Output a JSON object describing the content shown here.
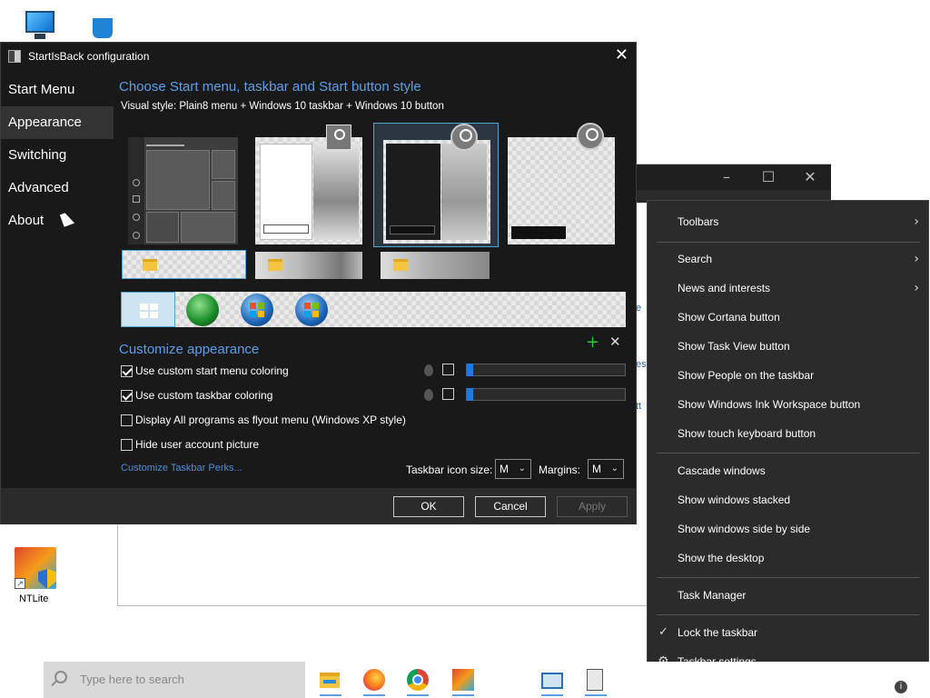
{
  "dialog": {
    "title": "StartIsBack configuration",
    "sidebar": [
      "Start Menu",
      "Appearance",
      "Switching",
      "Advanced",
      "About"
    ],
    "active_index": 1,
    "heading": "Choose Start menu, taskbar and Start button style",
    "visual_style": "Visual style:  Plain8 menu + Windows 10 taskbar + Windows 10 button",
    "customize_heading": "Customize appearance",
    "options": [
      {
        "label": "Use custom start menu coloring",
        "checked": true
      },
      {
        "label": "Use custom taskbar coloring",
        "checked": true
      },
      {
        "label": "Display All programs as flyout menu (Windows XP style)",
        "checked": false
      },
      {
        "label": "Hide user account picture",
        "checked": false
      }
    ],
    "perks_link": "Customize Taskbar Perks...",
    "icon_size_label": "Taskbar icon size:",
    "icon_size_value": "M",
    "margins_label": "Margins:",
    "margins_value": "M",
    "ok": "OK",
    "cancel": "Cancel",
    "apply": "Apply"
  },
  "desktop": {
    "ntlite_label": "NTLite"
  },
  "context_menu": {
    "items": [
      {
        "label": "Toolbars",
        "submenu": true
      },
      {
        "label": "Search",
        "submenu": true
      },
      {
        "label": "News and interests",
        "submenu": true
      },
      {
        "label": "Show Cortana button"
      },
      {
        "label": "Show Task View button"
      },
      {
        "label": "Show People on the taskbar"
      },
      {
        "label": "Show Windows Ink Workspace button"
      },
      {
        "label": "Show touch keyboard button"
      },
      {
        "label": "Cascade windows"
      },
      {
        "label": "Show windows stacked"
      },
      {
        "label": "Show windows side by side"
      },
      {
        "label": "Show the desktop"
      },
      {
        "label": "Task Manager"
      },
      {
        "label": "Lock the taskbar",
        "checked": true
      },
      {
        "label": "Taskbar settings",
        "icon": "gear-icon"
      }
    ]
  },
  "taskbar": {
    "search_placeholder": "Type here to search"
  },
  "colors": {
    "accent": "#5aa0e8",
    "dialog_bg": "#191919",
    "menu_bg": "#2b2b2b"
  }
}
